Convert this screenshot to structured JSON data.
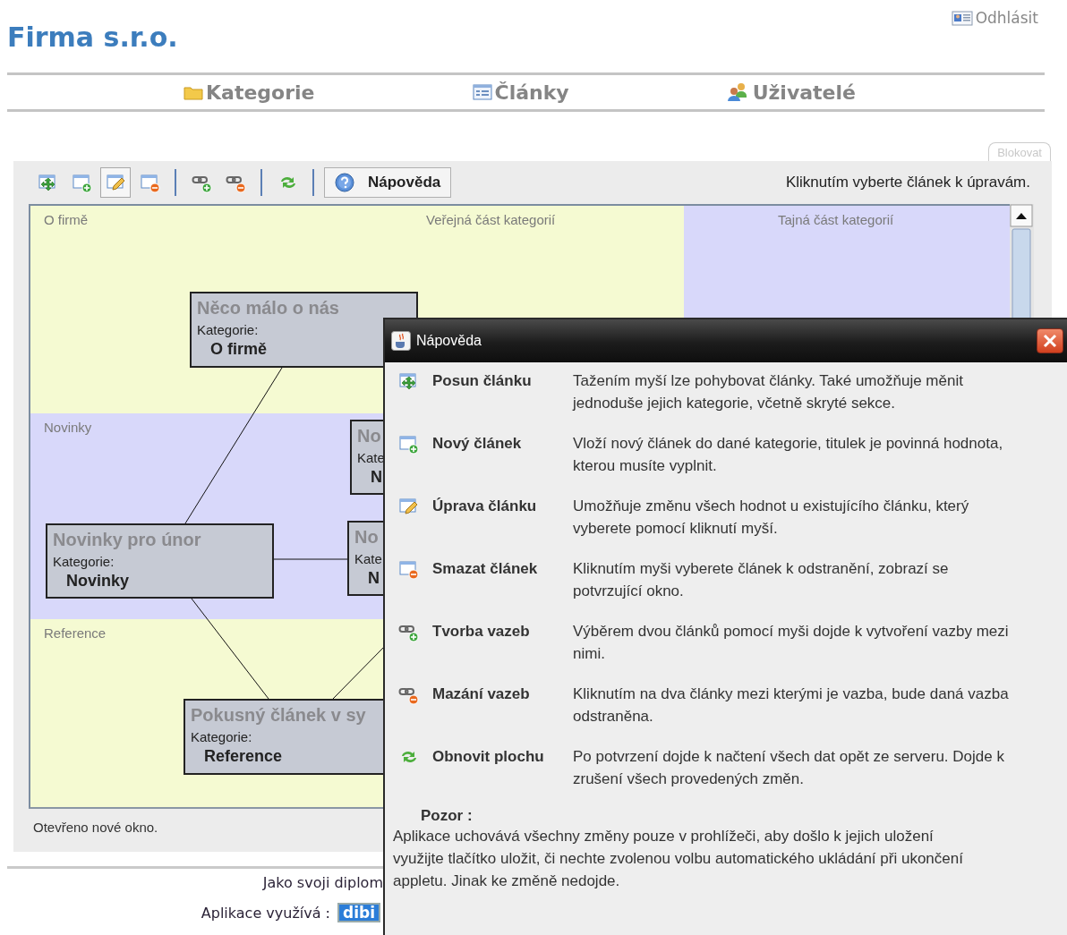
{
  "header": {
    "title": "Firma s.r.o.",
    "logout": "Odhlásit"
  },
  "nav": [
    {
      "kind": "folder",
      "label": "Kategorie"
    },
    {
      "kind": "list",
      "label": "Články"
    },
    {
      "kind": "users",
      "label": "Uživatelé"
    }
  ],
  "lock_tab": {
    "label": "Blokovat",
    "disabled": true
  },
  "toolbar": {
    "tool_groups": [
      [
        {
          "kind": "move",
          "selected": false
        },
        {
          "kind": "new",
          "selected": false
        },
        {
          "kind": "edit",
          "selected": true
        },
        {
          "kind": "delete",
          "selected": false
        }
      ],
      [
        {
          "kind": "link_add",
          "selected": false
        },
        {
          "kind": "link_remove",
          "selected": false
        }
      ],
      [
        {
          "kind": "refresh",
          "selected": false
        }
      ]
    ],
    "help_button": "Nápověda",
    "hint": "Kliknutím vyberte článek k úpravám."
  },
  "canvas": {
    "public_header": "Veřejná část kategorií",
    "secret_header": "Tajná část kategorií",
    "lanes": [
      {
        "name": "O firmě",
        "color": "#f5fad2"
      },
      {
        "name": "Novinky",
        "color": "#d8d8fa"
      },
      {
        "name": "Reference",
        "color": "#f5fad2"
      }
    ],
    "articles": [
      {
        "title": "Něco málo o nás",
        "category_label": "Kategorie:",
        "category": "O firmě"
      },
      {
        "title": "No",
        "category_label": "Kate",
        "category": "N"
      },
      {
        "title": "Novinky pro únor",
        "category_label": "Kategorie:",
        "category": "Novinky"
      },
      {
        "title": "No",
        "category_label": "Kate",
        "category": "N"
      },
      {
        "title": "Pokusný článek v sy",
        "category_label": "Kategorie:",
        "category": "Reference"
      }
    ]
  },
  "status": "Otevřeno nové okno.",
  "footer": {
    "thesis": "Jako svoji diplom",
    "uses_label": "Aplikace využívá :",
    "badge": "dibi"
  },
  "dialog": {
    "title": "Nápověda",
    "items": [
      {
        "kind": "move",
        "name": "Posun článku",
        "description": "Tažením myší lze pohybovat články. Také umožňuje měnit jednoduše jejich kategorie, včetně skryté sekce."
      },
      {
        "kind": "new",
        "name": "Nový článek",
        "description": "Vloží nový článek do dané kategorie, titulek je povinná hodnota, kterou musíte vyplnit."
      },
      {
        "kind": "edit",
        "name": "Úprava článku",
        "description": "Umožňuje změnu všech hodnot u existujícího článku, který vyberete pomocí kliknutí myší."
      },
      {
        "kind": "delete",
        "name": "Smazat článek",
        "description": "Kliknutím myši vyberete článek k odstranění, zobrazí se potvrzující okno."
      },
      {
        "kind": "link_add",
        "name": "Tvorba vazeb",
        "description": "Výběrem dvou článků pomocí myši dojde k vytvoření vazby mezi nimi."
      },
      {
        "kind": "link_remove",
        "name": "Mazání vazeb",
        "description": "Kliknutím na dva články mezi kterými je vazba, bude daná vazba odstraněna."
      },
      {
        "kind": "refresh",
        "name": "Obnovit plochu",
        "description": "Po potvrzení dojde k načtení všech dat opět ze serveru. Dojde k zrušení všech provedených změn."
      }
    ],
    "note_title": "Pozor :",
    "note": "Aplikace uchovává všechny změny pouze v prohlížeči, aby došlo k jejich uložení využijte tlačítko uložit, či nechte zvolenou volbu automatického ukládání při ukončení appletu. Jinak ke změně nedojde."
  }
}
